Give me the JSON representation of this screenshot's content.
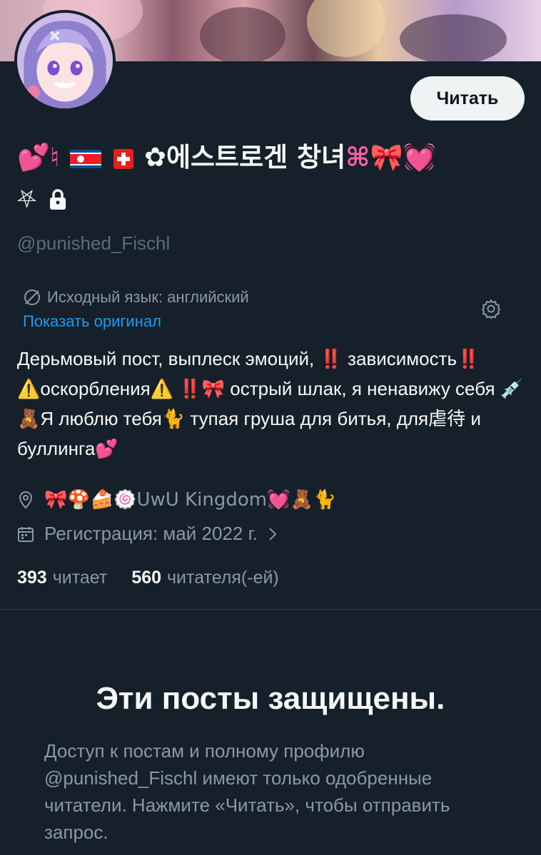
{
  "profile": {
    "follow_button": "Читать",
    "name_line1_prefix": "💕♮",
    "name_line1_korean": "✿에스트로겐 창녀",
    "name_line1_suffix": "⌘🎀💓",
    "name_line2_symbol": "⛧",
    "handle": "@punished_Fischl",
    "translation_note": "Исходный язык: английский",
    "show_original": "Показать оригинал",
    "bio": "Дерьмовый пост, выплеск эмоций, ‼️ зависимость‼️ ⚠️оскорбления⚠️ ‼️🎀 острый шлак, я ненавижу себя 💉🧸Я люблю тебя🐈 тупая груша для битья, для虐待 и буллинга💕",
    "location": "🎀🍄🍰🍥UwU Kingdom💓🧸🐈",
    "joined": "Регистрация: май 2022 г.",
    "following_count": "393",
    "following_label": "читает",
    "followers_count": "560",
    "followers_label": "читателя(-ей)"
  },
  "protected": {
    "title": "Эти посты защищены.",
    "description": "Доступ к постам и полному профилю @punished_Fischl имеют только одобренные читатели. Нажмите «Читать», чтобы отправить запрос."
  },
  "icons": {
    "translate": "translate-icon",
    "settings": "gear-icon",
    "location": "location-pin-icon",
    "calendar": "calendar-icon",
    "lock": "lock-icon",
    "chevron": "chevron-right-icon"
  },
  "colors": {
    "background": "#15202b",
    "text": "#f7f9f9",
    "muted": "#8b98a5",
    "link": "#1d9bf0",
    "button_bg": "#eff3f4"
  }
}
